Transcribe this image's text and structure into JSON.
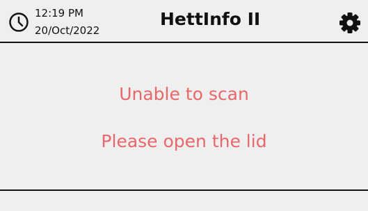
{
  "header": {
    "time": "12:19 PM",
    "date": "20/Oct/2022",
    "title": "HettInfo II",
    "clock_icon": "clock-icon",
    "settings_icon": "gear-icon"
  },
  "main": {
    "message_line1": "Unable to scan",
    "message_line2": "Please open the lid",
    "message_color": "#e8676a"
  }
}
